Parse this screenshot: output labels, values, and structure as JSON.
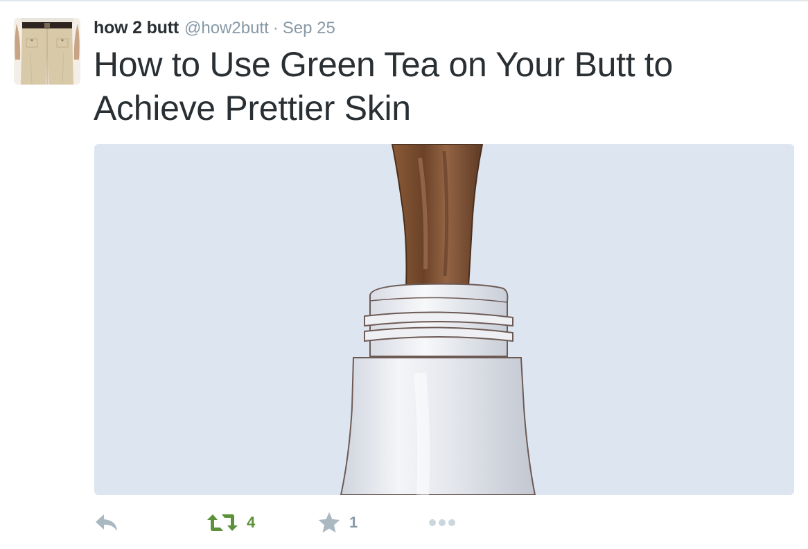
{
  "tweet": {
    "display_name": "how 2 butt",
    "handle": "@how2butt",
    "separator": "·",
    "timestamp": "Sep 25",
    "text": "How to Use Green Tea on Your Butt to Achieve Prettier Skin"
  },
  "actions": {
    "retweet_count": "4",
    "favorite_count": "1"
  },
  "icons": {
    "reply": "reply-icon",
    "retweet": "retweet-icon",
    "favorite": "star-icon",
    "more": "more-dots-icon"
  },
  "colors": {
    "text": "#292f33",
    "muted": "#8899a6",
    "retweeted": "#5c913b",
    "media_background": "#dde6f0"
  }
}
